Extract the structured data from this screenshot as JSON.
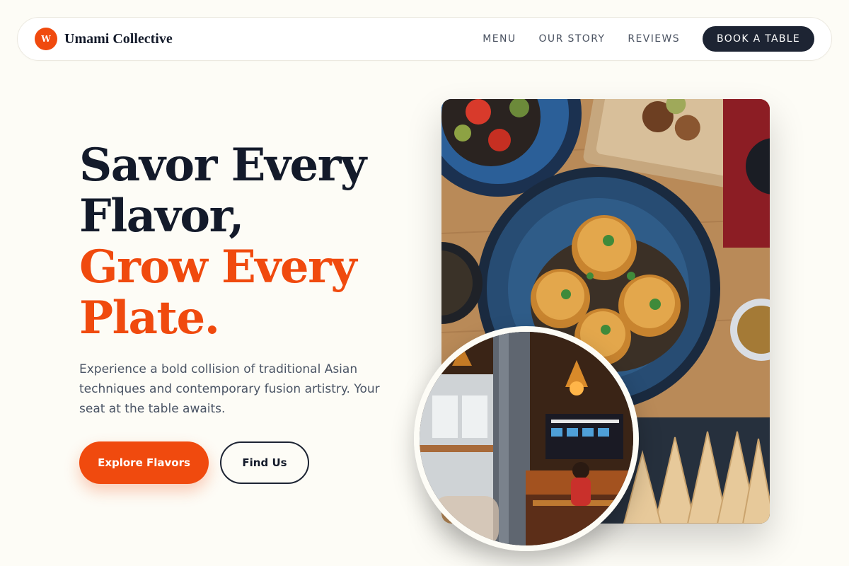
{
  "brand": {
    "logo_letter": "W",
    "name": "Umami Collective"
  },
  "nav": {
    "links": [
      "MENU",
      "OUR STORY",
      "REVIEWS"
    ],
    "cta": "BOOK A TABLE"
  },
  "hero": {
    "title_line1": "Savor Every",
    "title_line2": "Flavor,",
    "title_line3": "Grow Every",
    "title_line4": "Plate.",
    "subtitle": "Experience a bold collision of traditional Asian techniques and contemporary fusion artistry. Your seat at the table awaits.",
    "primary_button": "Explore Flavors",
    "secondary_button": "Find Us"
  },
  "images": {
    "food": "overhead-asian-dishes-photo",
    "interior": "restaurant-interior-photo"
  },
  "colors": {
    "accent": "#f04a0e",
    "dark": "#1d2433",
    "background": "#fdfcf6"
  }
}
